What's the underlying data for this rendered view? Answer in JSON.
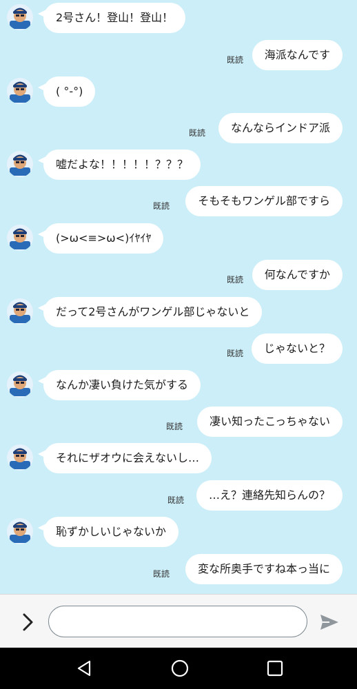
{
  "messages": [
    {
      "from": "them",
      "text": "2号さん！登山！登山！"
    },
    {
      "from": "me",
      "text": "海派なんです",
      "read": "既読"
    },
    {
      "from": "them",
      "text": "( °-°)"
    },
    {
      "from": "me",
      "text": "なんならインドア派",
      "read": "既読"
    },
    {
      "from": "them",
      "text": "嘘だよな！！！！！？？？"
    },
    {
      "from": "me",
      "text": "そもそもワンゲル部ですら",
      "read": "既読"
    },
    {
      "from": "them",
      "text": "(>ω<≡>ω<)ｲﾔｲﾔ"
    },
    {
      "from": "me",
      "text": "何なんですか",
      "read": "既読"
    },
    {
      "from": "them",
      "text": "だって2号さんがワンゲル部じゃないと"
    },
    {
      "from": "me",
      "text": "じゃないと？",
      "read": "既読"
    },
    {
      "from": "them",
      "text": "なんか凄い負けた気がする"
    },
    {
      "from": "me",
      "text": "凄い知ったこっちゃない",
      "read": "既読"
    },
    {
      "from": "them",
      "text": "それにザオウに会えないし…"
    },
    {
      "from": "me",
      "text": "…え？連絡先知らんの？",
      "read": "既読"
    },
    {
      "from": "them",
      "text": "恥ずかしいじゃないか"
    },
    {
      "from": "me",
      "text": "変な所奥手ですね本っ当に",
      "read": "既読"
    }
  ],
  "input": {
    "value": "",
    "placeholder": ""
  },
  "icons": {
    "avatar": "character-avatar-icon",
    "expand": "chevron-right-icon",
    "send": "send-icon",
    "nav_back": "back-triangle-icon",
    "nav_home": "home-circle-icon",
    "nav_recents": "recents-square-icon"
  },
  "colors": {
    "chat_background": "#cceef8",
    "bubble": "#ffffff",
    "input_bar": "#f6f6f6",
    "nav_bar": "#000000"
  }
}
